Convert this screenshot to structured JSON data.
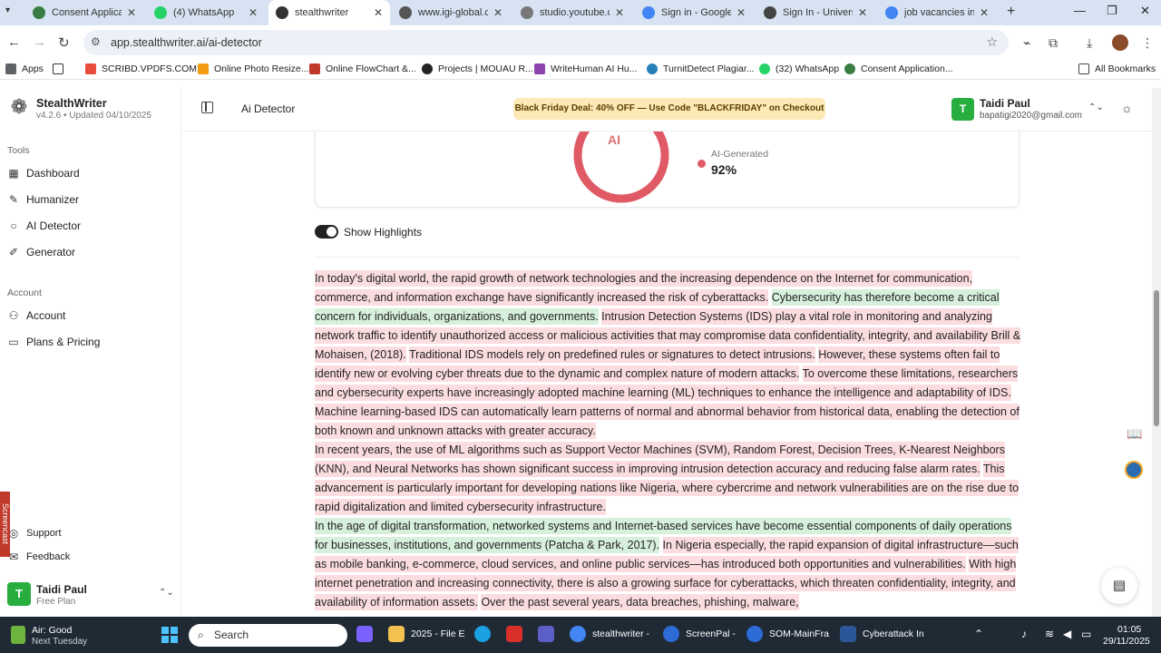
{
  "browser": {
    "tabs": [
      {
        "label": "Consent Applicati",
        "color": "#3a7d44",
        "active": false
      },
      {
        "label": "(4) WhatsApp",
        "color": "#25d366",
        "active": false
      },
      {
        "label": "stealthwriter",
        "color": "#333333",
        "active": true
      },
      {
        "label": "www.igi-global.co",
        "color": "#555555",
        "active": false
      },
      {
        "label": "studio.youtube.co",
        "color": "#777777",
        "active": false
      },
      {
        "label": "Sign in - Google A",
        "color": "#4285f4",
        "active": false
      },
      {
        "label": "Sign In - Universit",
        "color": "#444444",
        "active": false
      },
      {
        "label": "job vacancies in n",
        "color": "#4285f4",
        "active": false
      }
    ],
    "url": "app.stealthwriter.ai/ai-detector",
    "bookmarks": [
      {
        "label": "Apps",
        "color": "#5f6368"
      },
      {
        "label": "SCRIBD.VPDFS.COM...",
        "color": "#e74c3c"
      },
      {
        "label": "Online Photo Resize...",
        "color": "#f39c12"
      },
      {
        "label": "Online FlowChart &...",
        "color": "#c0392b"
      },
      {
        "label": "Projects | MOUAU R...",
        "color": "#222222"
      },
      {
        "label": "WriteHuman AI Hu...",
        "color": "#8e44ad"
      },
      {
        "label": "TurnitDetect Plagiar...",
        "color": "#2980b9"
      },
      {
        "label": "(32) WhatsApp",
        "color": "#25d366"
      },
      {
        "label": "Consent Application...",
        "color": "#3a7d44"
      }
    ],
    "all_bookmarks": "All Bookmarks"
  },
  "app": {
    "brand": "StealthWriter",
    "version": "v4.2.6 • Updated 04/10/2025",
    "tools_title": "Tools",
    "tools": [
      {
        "label": "Dashboard",
        "icon": "dashboard-icon"
      },
      {
        "label": "Humanizer",
        "icon": "humanizer-icon"
      },
      {
        "label": "AI Detector",
        "icon": "detector-icon"
      },
      {
        "label": "Generator",
        "icon": "generator-icon"
      }
    ],
    "account_title": "Account",
    "account_items": [
      {
        "label": "Account",
        "icon": "user-icon"
      },
      {
        "label": "Plans & Pricing",
        "icon": "card-icon"
      }
    ],
    "support": "Support",
    "feedback": "Feedback",
    "user": {
      "initial": "T",
      "name": "Taidi Paul",
      "plan": "Free Plan",
      "email": "bapatigi2020@gmail.com"
    },
    "header_title": "Ai Detector",
    "promo": "Black Friday Deal: 40% OFF — Use Code \"BLACKFRIDAY\" on Checkout"
  },
  "result": {
    "gauge_label": "AI",
    "human_pct": "8%",
    "ai_label": "AI-Generated",
    "ai_pct": "92%",
    "ai_fraction": 0.92,
    "ai_color": "#e05a66",
    "human_color": "#f5c4c8"
  },
  "highlights": {
    "label": "Show Highlights",
    "on": true,
    "segments": [
      {
        "type": "red",
        "text": "In today's digital world, the rapid growth of network technologies and the increasing dependence on the Internet for communication, commerce, and information exchange have significantly increased the risk of cyberattacks."
      },
      {
        "type": "green",
        "text": "Cybersecurity has therefore become a critical concern for individuals, organizations, and governments."
      },
      {
        "type": "red",
        "text": "Intrusion Detection Systems (IDS) play a vital role in monitoring and analyzing network traffic to identify unauthorized access or malicious activities that may compromise data confidentiality, integrity, and availability Brill & Mohaisen, (2018)."
      },
      {
        "type": "red",
        "text": "Traditional IDS models rely on predefined rules or signatures to detect intrusions."
      },
      {
        "type": "red",
        "text": "However, these systems often fail to identify new or evolving cyber threats due to the dynamic and complex nature of modern attacks."
      },
      {
        "type": "red",
        "text": "To overcome these limitations, researchers and cybersecurity experts have increasingly adopted machine learning (ML) techniques to enhance the intelligence and adaptability of IDS."
      },
      {
        "type": "red",
        "text": "Machine learning-based IDS can automatically learn patterns of normal and abnormal behavior from historical data, enabling the detection of both known and unknown attacks with greater accuracy."
      },
      {
        "type": "break"
      },
      {
        "type": "red",
        "text": "In recent years, the use of ML algorithms such as Support Vector Machines (SVM), Random Forest, Decision Trees, K-Nearest Neighbors (KNN), and Neural Networks has shown significant success in improving intrusion detection accuracy and reducing false alarm rates."
      },
      {
        "type": "red",
        "text": "This advancement is particularly important for developing nations like Nigeria, where cybercrime and network vulnerabilities are on the rise due to rapid digitalization and limited cybersecurity infrastructure."
      },
      {
        "type": "break"
      },
      {
        "type": "green",
        "text": "In the age of digital transformation, networked systems and Internet-based services have become essential components of daily operations for businesses, institutions, and governments (Patcha & Park, 2017)."
      },
      {
        "type": "red",
        "text": "In Nigeria especially, the rapid expansion of digital infrastructure—such as mobile banking, e-commerce, cloud services, and online public services—has introduced both opportunities and vulnerabilities."
      },
      {
        "type": "red",
        "text": "With high internet penetration and increasing connectivity, there is also a growing surface for cyberattacks, which threaten confidentiality, integrity, and availability of information assets."
      },
      {
        "type": "red",
        "text": "Over the past several years, data breaches, phishing, malware,"
      }
    ]
  },
  "taskbar": {
    "weather_a": "Air: Good",
    "weather_b": "Next Tuesday",
    "search": "Search",
    "apps": [
      {
        "label": "2025 - File E",
        "color": "#f2c14e"
      },
      {
        "label": "stealthwriter -",
        "color": "#4285f4"
      },
      {
        "label": "ScreenPal -",
        "color": "#2d6bd6"
      },
      {
        "label": "SOM-MainFra",
        "color": "#2d6bd6"
      },
      {
        "label": "Cyberattack In",
        "color": "#2b579a"
      }
    ],
    "time": "01:05",
    "date": "29/11/2025"
  },
  "screenrec_label": "Screencast"
}
